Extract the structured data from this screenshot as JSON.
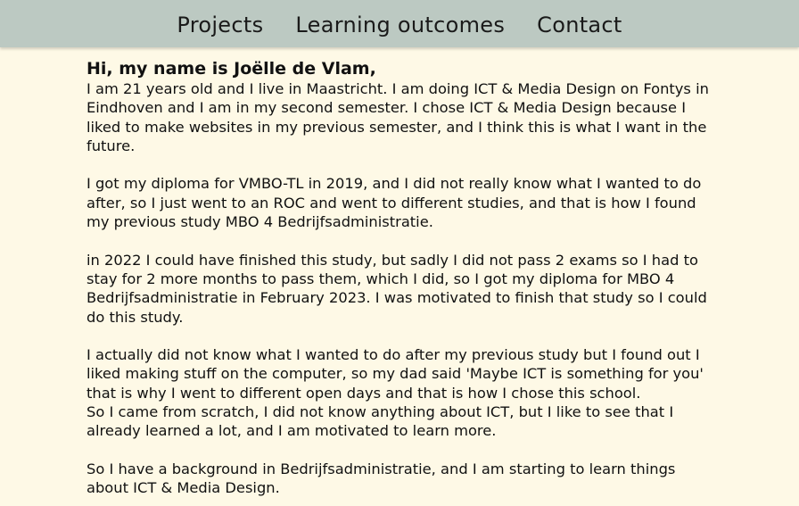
{
  "nav": {
    "items": [
      {
        "label": "Projects"
      },
      {
        "label": "Learning outcomes"
      },
      {
        "label": "Contact"
      }
    ]
  },
  "main": {
    "greeting": "Hi, my name is Joëlle de Vlam,",
    "paragraphs": [
      "I am 21 years old and I live in Maastricht. I am doing ICT & Media Design on Fontys in\nEindhoven and I am in my second semester. I chose ICT & Media Design because I\nliked to make websites in my previous semester, and I think this is what I want in the\nfuture.",
      "I got my diploma for VMBO-TL in 2019, and I did not really know what I wanted to do\nafter, so I just went to an ROC and went to different studies, and that is how I found\nmy previous study MBO 4 Bedrijfsadministratie.",
      "in 2022 I could have finished this study, but sadly I did not pass 2 exams so I had to\nstay for 2 more months to pass them, which I did, so I got my diploma for MBO 4\nBedrijfsadministratie in February 2023. I was motivated to finish that study so I could\ndo this study.",
      "I actually did not know what I wanted to do after my previous study but I found out I\nliked making stuff on the computer, so my dad said 'Maybe ICT is something for you'\nthat is why I went to different open days and that is how I chose this school.",
      "So I came from scratch, I did not know anything about ICT, but I like to see that I\nalready learned a lot, and I am motivated to learn more.",
      "So I have a background in Bedrijfsadministratie, and I am starting to learn things\nabout ICT & Media Design."
    ]
  }
}
